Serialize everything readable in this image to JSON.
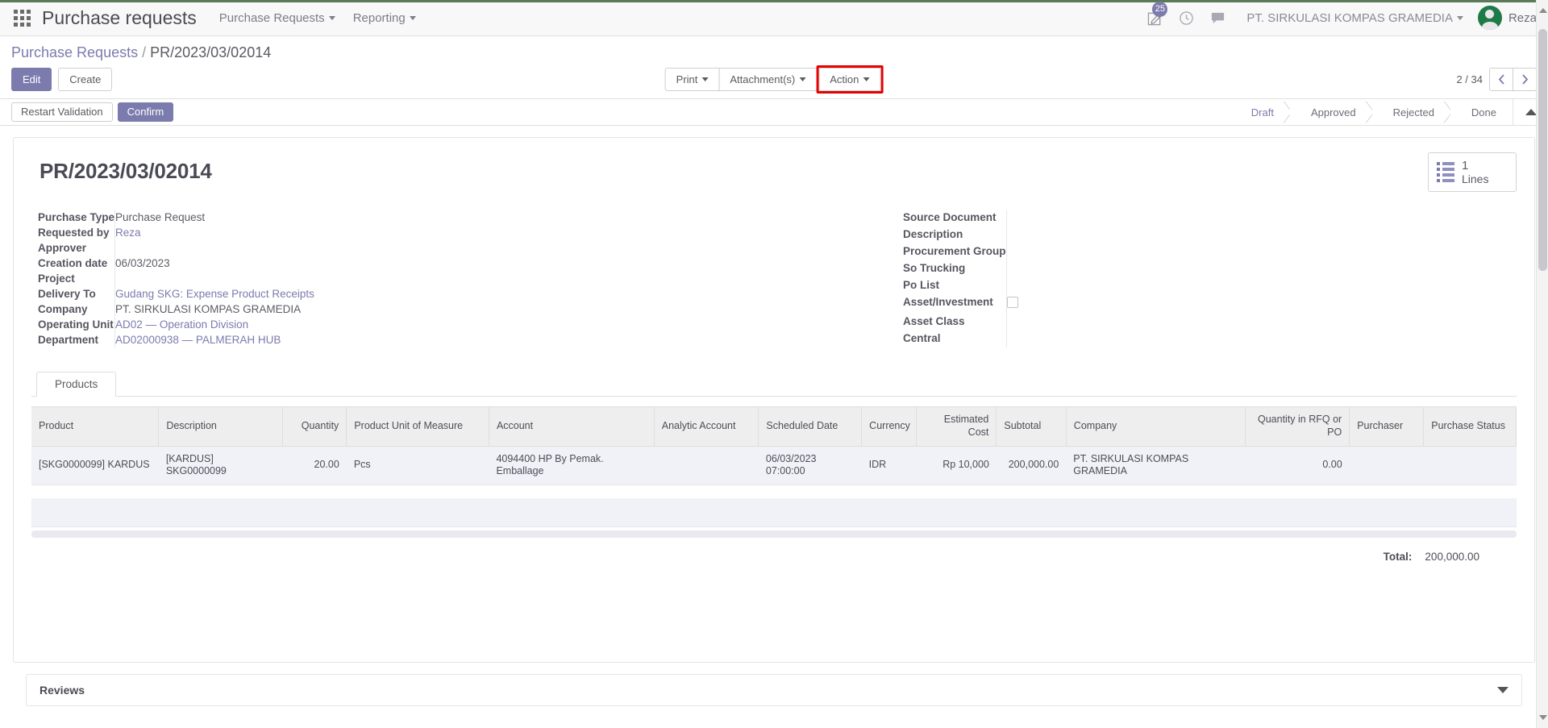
{
  "topbar": {
    "apps_icon": "apps-grid-icon",
    "app_title": "Purchase requests",
    "menus": [
      {
        "label": "Purchase Requests"
      },
      {
        "label": "Reporting"
      }
    ],
    "activity_badge": "25",
    "activity_icon": "pencil-square-icon",
    "clock_icon": "clock-icon",
    "messages_icon": "chat-bubble-icon",
    "company": "PT. SIRKULASI KOMPAS GRAMEDIA",
    "user": "Reza",
    "badge_color": "#7c7bad"
  },
  "controlpanel": {
    "breadcrumb_root": "Purchase Requests",
    "breadcrumb_sep": "/",
    "breadcrumb_current": "PR/2023/03/02014",
    "edit_label": "Edit",
    "create_label": "Create",
    "print_label": "Print",
    "attachments_label": "Attachment(s)",
    "action_label": "Action",
    "action_highlight_color": "#e60000",
    "pager": "2 / 34",
    "prev_icon": "chevron-left-icon",
    "next_icon": "chevron-right-icon"
  },
  "statusbar": {
    "restart_validation_label": "Restart Validation",
    "confirm_label": "Confirm",
    "steps": [
      {
        "label": "Draft",
        "active": true
      },
      {
        "label": "Approved",
        "active": false
      },
      {
        "label": "Rejected",
        "active": false
      },
      {
        "label": "Done",
        "active": false
      }
    ],
    "collapse_icon": "triangle-up-icon"
  },
  "record": {
    "title": "PR/2023/03/02014",
    "stat_button": {
      "icon": "list-lines-icon",
      "value": "1",
      "label": "Lines"
    }
  },
  "form": {
    "left_fields": [
      {
        "label": "Purchase Type",
        "value": "Purchase Request",
        "link": false
      },
      {
        "label": "Requested by",
        "value": "Reza",
        "link": true
      },
      {
        "label": "Approver",
        "value": "",
        "link": false
      },
      {
        "label": "Creation date",
        "value": "06/03/2023",
        "link": false
      },
      {
        "label": "Project",
        "value": "",
        "link": false
      },
      {
        "label": "Delivery To",
        "value": "Gudang SKG: Expense Product Receipts",
        "link": true
      },
      {
        "label": "Company",
        "value": "PT. SIRKULASI KOMPAS GRAMEDIA",
        "link": false
      },
      {
        "label": "Operating Unit",
        "value": "AD02 — Operation Division",
        "link": true
      },
      {
        "label": "Department",
        "value": "AD02000938 — PALMERAH HUB",
        "link": true
      }
    ],
    "right_fields": [
      {
        "label": "Source Document",
        "value": "",
        "type": "text"
      },
      {
        "label": "Description",
        "value": "",
        "type": "text"
      },
      {
        "label": "Procurement Group",
        "value": "",
        "type": "text"
      },
      {
        "label": "So Trucking",
        "value": "",
        "type": "text"
      },
      {
        "label": "Po List",
        "value": "",
        "type": "text"
      },
      {
        "label": "Asset/Investment",
        "value": "",
        "type": "checkbox",
        "checked": false
      },
      {
        "label": "Asset Class",
        "value": "",
        "type": "text"
      },
      {
        "label": "Central",
        "value": "",
        "type": "text"
      }
    ]
  },
  "notebook": {
    "tabs": [
      {
        "label": "Products",
        "active": true
      }
    ]
  },
  "lines_table": {
    "columns": [
      "Product",
      "Description",
      "Quantity",
      "Product Unit of Measure",
      "Account",
      "Analytic Account",
      "Scheduled Date",
      "Currency",
      "Estimated Cost",
      "Subtotal",
      "Company",
      "Quantity in RFQ or PO",
      "Purchaser",
      "Purchase Status"
    ],
    "rows": [
      {
        "product": "[SKG0000099] KARDUS",
        "description": "[KARDUS] SKG0000099",
        "quantity": "20.00",
        "uom": "Pcs",
        "account": "4094400 HP By Pemak. Emballage",
        "analytic_account": "",
        "scheduled_date": "06/03/2023 07:00:00",
        "currency": "IDR",
        "estimated_cost": "Rp 10,000",
        "subtotal": "200,000.00",
        "company": "PT. SIRKULASI KOMPAS GRAMEDIA",
        "qty_rfq_po": "0.00",
        "purchaser": "",
        "purchase_status": ""
      }
    ],
    "total_label": "Total:",
    "total_value": "200,000.00"
  },
  "reviews": {
    "title": "Reviews",
    "toggle_icon": "triangle-down-icon"
  }
}
